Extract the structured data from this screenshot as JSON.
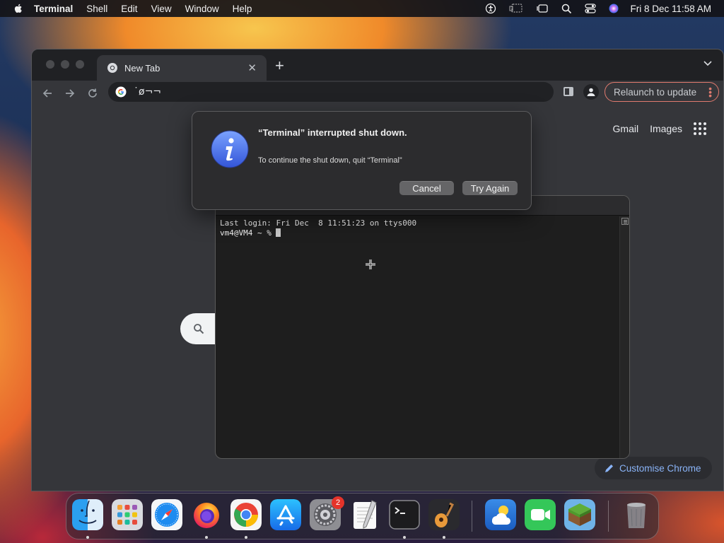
{
  "menubar": {
    "app_name": "Terminal",
    "menus": [
      "Shell",
      "Edit",
      "View",
      "Window",
      "Help"
    ],
    "clock": "Fri 8 Dec  11:58 AM"
  },
  "chrome": {
    "tab_title": "New Tab",
    "address_value": "˙ø¬¬",
    "relaunch_label": "Relaunch to update",
    "ntp_gmail": "Gmail",
    "ntp_images": "Images",
    "customise_label": "Customise Chrome"
  },
  "terminal": {
    "line1": "Last login: Fri Dec  8 11:51:23 on ttys000",
    "prompt": "vm4@VM4 ~ % "
  },
  "alert": {
    "title": "“Terminal” interrupted shut down.",
    "message": "To continue the shut down, quit “Terminal”",
    "cancel_label": "Cancel",
    "try_again_label": "Try Again"
  },
  "dock": {
    "settings_badge": "2",
    "apps": [
      "finder-icon",
      "launchpad-icon",
      "safari-icon",
      "firefox-icon",
      "chrome-icon",
      "app-store-icon",
      "system-settings-icon",
      "textedit-icon",
      "terminal-icon",
      "garageband-icon",
      "weather-icon",
      "facetime-icon",
      "minecraft-icon",
      "trash-icon"
    ]
  },
  "colors": {
    "alert_bg": "#2c2c2e",
    "chrome_bg": "#35363a",
    "accent_link": "#8ab4f8",
    "relaunch_border": "#e07a6e",
    "badge": "#e5332a"
  }
}
